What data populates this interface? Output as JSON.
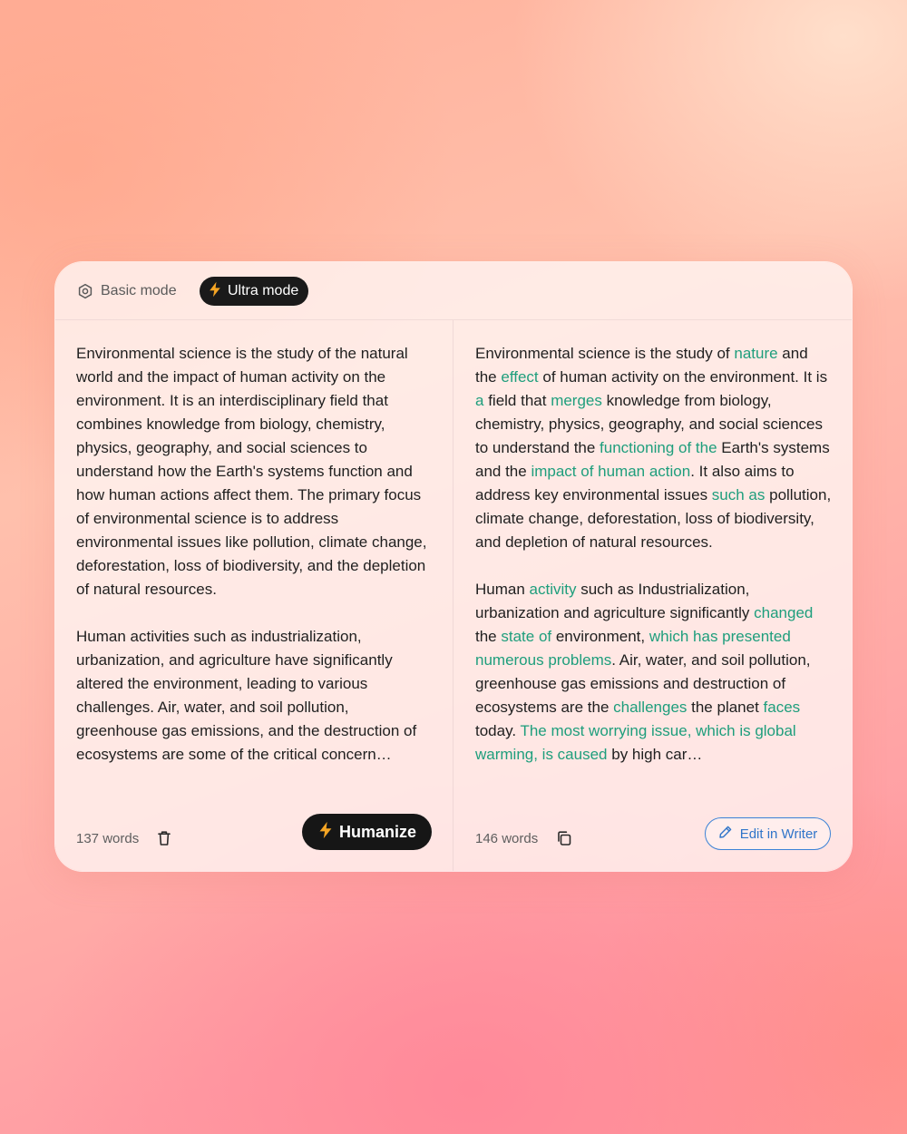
{
  "modes": {
    "basic_label": "Basic mode",
    "ultra_label": "Ultra mode",
    "selected": "Ultra mode"
  },
  "input": {
    "paragraphs": [
      "Environmental science is the study of the natural world and the impact of human activity on the environment. It is an interdisciplinary field that combines knowledge from biology, chemistry, physics, geography, and social sciences to understand how the Earth's systems function and how human actions affect them. The primary focus of environmental science is to address environmental issues like pollution, climate change, deforestation, loss of biodiversity, and the depletion of natural resources.",
      "Human activities such as industrialization, urbanization, and agriculture have significantly altered the environment, leading to various challenges. Air, water, and soil pollution, greenhouse gas emissions, and the destruction of ecosystems are some of the critical concern…"
    ],
    "word_count": "137 words",
    "humanize_label": "Humanize"
  },
  "output": {
    "paragraphs": [
      [
        {
          "text": "Environmental science is the study of ",
          "changed": false
        },
        {
          "text": "nature",
          "changed": true
        },
        {
          "text": " and the ",
          "changed": false
        },
        {
          "text": "effect",
          "changed": true
        },
        {
          "text": " of human activity on the environment. It is ",
          "changed": false
        },
        {
          "text": "a",
          "changed": true
        },
        {
          "text": " field that ",
          "changed": false
        },
        {
          "text": "merges",
          "changed": true
        },
        {
          "text": " knowledge from biology, chemistry, physics, geography, and social sciences to understand the ",
          "changed": false
        },
        {
          "text": "functioning of the",
          "changed": true
        },
        {
          "text": " Earth's systems and the ",
          "changed": false
        },
        {
          "text": "impact of human action",
          "changed": true
        },
        {
          "text": ". It also aims to address key environmental issues ",
          "changed": false
        },
        {
          "text": "such as",
          "changed": true
        },
        {
          "text": " pollution, climate change, deforestation, loss of biodiversity, and depletion of natural resources.",
          "changed": false
        }
      ],
      [
        {
          "text": "Human ",
          "changed": false
        },
        {
          "text": "activity",
          "changed": true
        },
        {
          "text": " such as Industrialization, urbanization and agriculture significantly ",
          "changed": false
        },
        {
          "text": "changed",
          "changed": true
        },
        {
          "text": " the ",
          "changed": false
        },
        {
          "text": "state of",
          "changed": true
        },
        {
          "text": " environment, ",
          "changed": false
        },
        {
          "text": "which has presented numerous problems",
          "changed": true
        },
        {
          "text": ". Air, water, and soil pollution, greenhouse gas emissions and destruction of ecosystems are the ",
          "changed": false
        },
        {
          "text": "challenges",
          "changed": true
        },
        {
          "text": " the planet ",
          "changed": false
        },
        {
          "text": "faces",
          "changed": true
        },
        {
          "text": " today. ",
          "changed": false
        },
        {
          "text": "The most worrying issue, which is global warming, is caused",
          "changed": true
        },
        {
          "text": " by high car…",
          "changed": false
        }
      ]
    ],
    "word_count": "146 words",
    "edit_label": "Edit in Writer"
  },
  "colors": {
    "changed_text": "#1e9e7c",
    "primary_button": "#161616",
    "edit_button": "#3b82d6",
    "bolt": "#f5a524"
  },
  "icons": {
    "basic_mode": "hexagon-gear-icon",
    "ultra_mode": "lightning-bolt-icon",
    "clear": "trash-icon",
    "copy": "copy-icon",
    "edit": "pencil-icon"
  }
}
